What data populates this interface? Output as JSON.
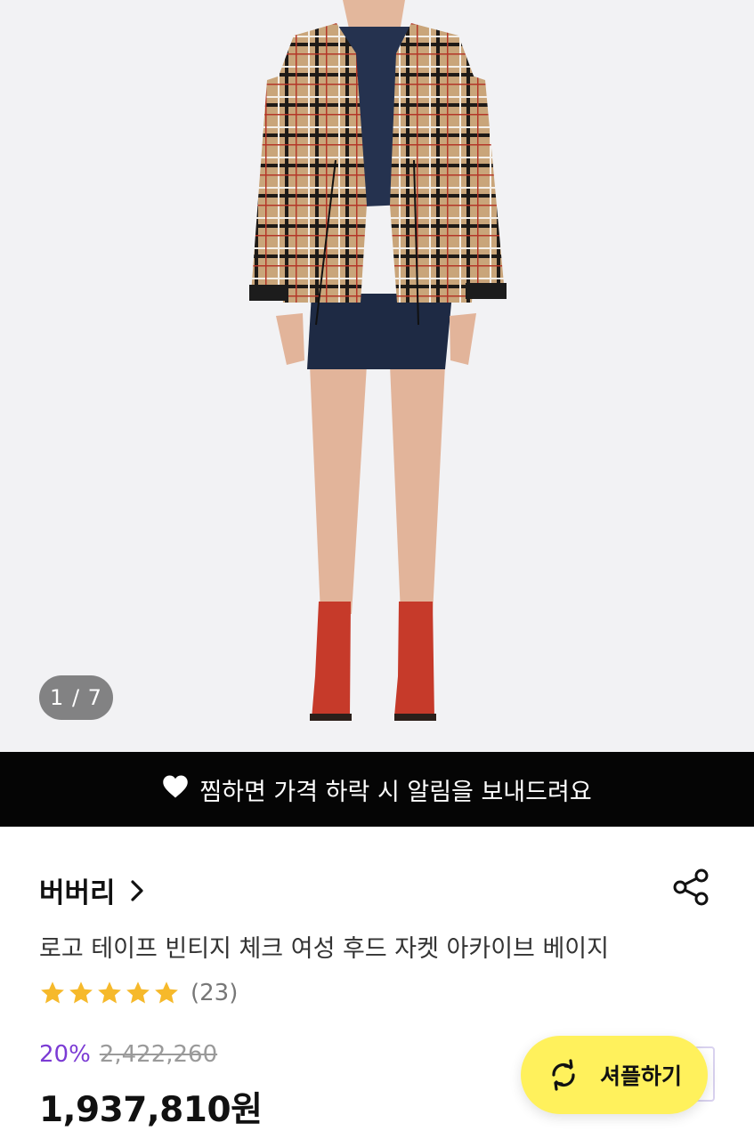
{
  "gallery": {
    "image_counter": "1 / 7",
    "image_alt": "product-photo-model-wearing-check-hooded-jacket"
  },
  "wishlist_banner": {
    "icon": "heart-icon",
    "text": "찜하면 가격 하락 시 알림을 보내드려요"
  },
  "product": {
    "brand": "버버리",
    "brand_chevron_icon": "chevron-right-icon",
    "share_icon": "share-icon",
    "title": "로고 테이프 빈티지 체크 여성 후드 자켓 아카이브 베이지",
    "rating": {
      "stars": 5,
      "review_count": "(23)"
    },
    "discount": "20%",
    "original_price": "2,422,260",
    "price": "1,937,810원"
  },
  "shuffle_button": {
    "label": "셔플하기",
    "icon": "refresh-icon"
  },
  "colors": {
    "discount": "#7b3bd4",
    "star": "#f6b92b",
    "shuffle_bg": "#fff15c",
    "banner_bg": "#050505",
    "gallery_bg": "#f2f2f4"
  }
}
